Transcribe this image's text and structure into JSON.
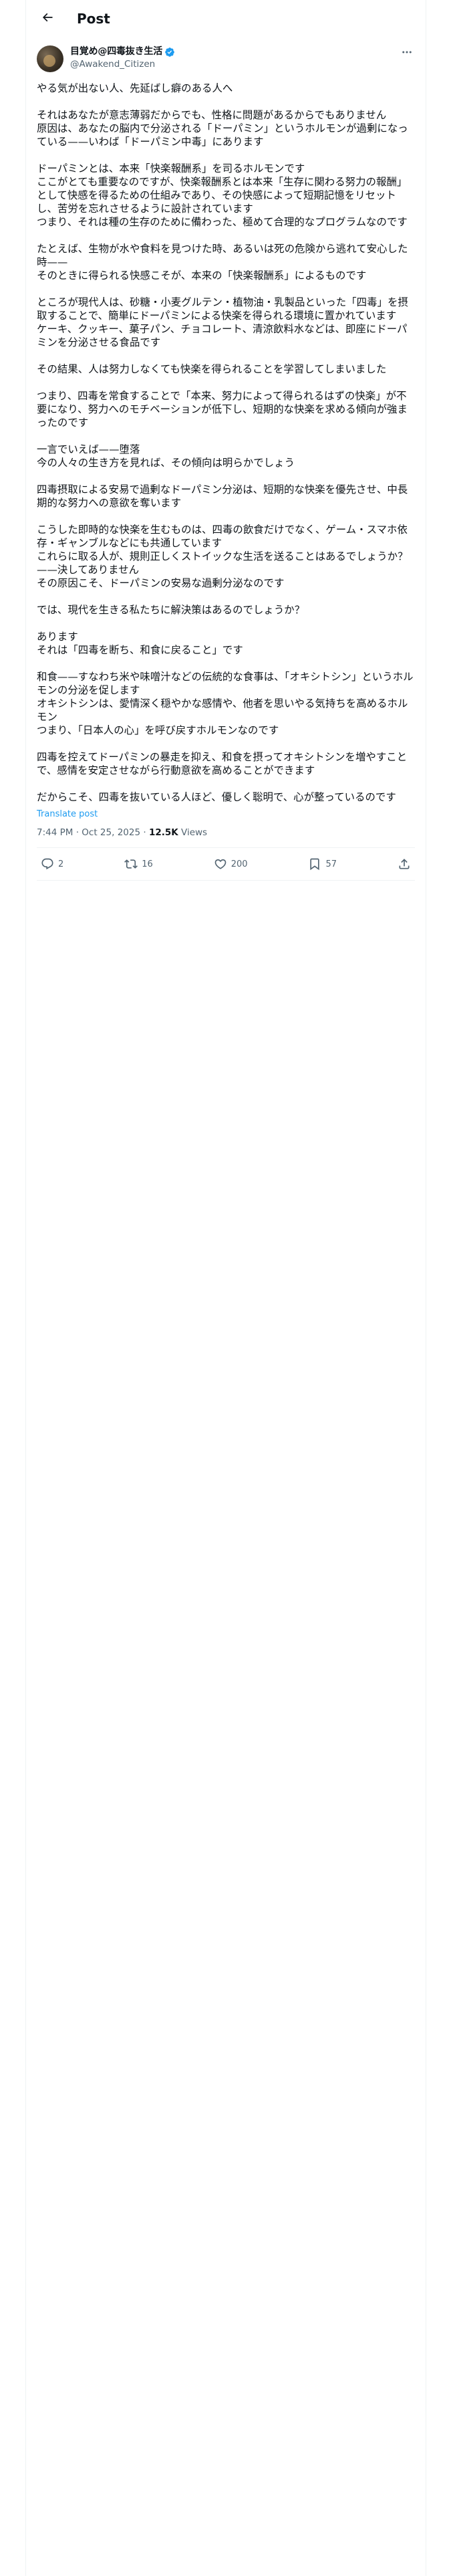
{
  "header": {
    "title": "Post",
    "back_icon": "back-arrow-icon"
  },
  "author": {
    "display_name": "目覚め@四毒抜き生活",
    "handle": "@Awakend_Citizen",
    "verified": true,
    "verified_color": "#1d9bf0"
  },
  "post": {
    "text": "やる気が出ない人、先延ばし癖のある人へ\n\nそれはあなたが意志薄弱だからでも、性格に問題があるからでもありません\n原因は、あなたの脳内で分泌される「ドーパミン」というホルモンが過剰になっている——いわば「ドーパミン中毒」にあります\n\nドーパミンとは、本来「快楽報酬系」を司るホルモンです\nここがとても重要なのですが、快楽報酬系とは本来「生存に関わる努力の報酬」として快感を得るための仕組みであり、その快感によって短期記憶をリセットし、苦労を忘れさせるように設計されています\nつまり、それは種の生存のために備わった、極めて合理的なプログラムなのです\n\nたとえば、生物が水や食料を見つけた時、あるいは死の危険から逃れて安心した時——\nそのときに得られる快感こそが、本来の「快楽報酬系」によるものです\n\nところが現代人は、砂糖・小麦グルテン・植物油・乳製品といった「四毒」を摂取することで、簡単にドーパミンによる快楽を得られる環境に置かれています\nケーキ、クッキー、菓子パン、チョコレート、清涼飲料水などは、即座にドーパミンを分泌させる食品です\n\nその結果、人は努力しなくても快楽を得られることを学習してしまいました\n\nつまり、四毒を常食することで「本来、努力によって得られるはずの快楽」が不要になり、努力へのモチベーションが低下し、短期的な快楽を求める傾向が強まったのです\n\n一言でいえば——堕落\n今の人々の生き方を見れば、その傾向は明らかでしょう\n\n四毒摂取による安易で過剰なドーパミン分泌は、短期的な快楽を優先させ、中長期的な努力への意欲を奪います\n\nこうした即時的な快楽を生むものは、四毒の飲食だけでなく、ゲーム・スマホ依存・ギャンブルなどにも共通しています\nこれらに取る人が、規則正しくストイックな生活を送ることはあるでしょうか？\n——決してありません\nその原因こそ、ドーパミンの安易な過剰分泌なのです\n\nでは、現代を生きる私たちに解決策はあるのでしょうか？\n\nあります\nそれは「四毒を断ち、和食に戻ること」です\n\n和食——すなわち米や味噌汁などの伝統的な食事は、「オキシトシン」というホルモンの分泌を促します\nオキシトシンは、愛情深く穏やかな感情や、他者を思いやる気持ちを高めるホルモン\nつまり、「日本人の心」を呼び戻すホルモンなのです\n\n四毒を控えてドーパミンの暴走を抑え、和食を摂ってオキシトシンを増やすことで、感情を安定させながら行動意欲を高めることができます\n\nだからこそ、四毒を抜いている人ほど、優しく聡明で、心が整っているのです"
  },
  "translate_label": "Translate post",
  "meta": {
    "time": "7:44 PM",
    "separator": "·",
    "date": "Oct 25, 2025",
    "views_count": "12.5K",
    "views_label": "Views"
  },
  "actions": {
    "replies": "2",
    "reposts": "16",
    "likes": "200",
    "bookmarks": "57",
    "reply_icon": "reply-icon",
    "repost_icon": "repost-icon",
    "like_icon": "heart-icon",
    "bookmark_icon": "bookmark-icon",
    "share_icon": "share-icon"
  },
  "colors": {
    "text": "#0f1419",
    "secondary": "#536471",
    "accent": "#1d9bf0",
    "border": "#eff3f4"
  }
}
